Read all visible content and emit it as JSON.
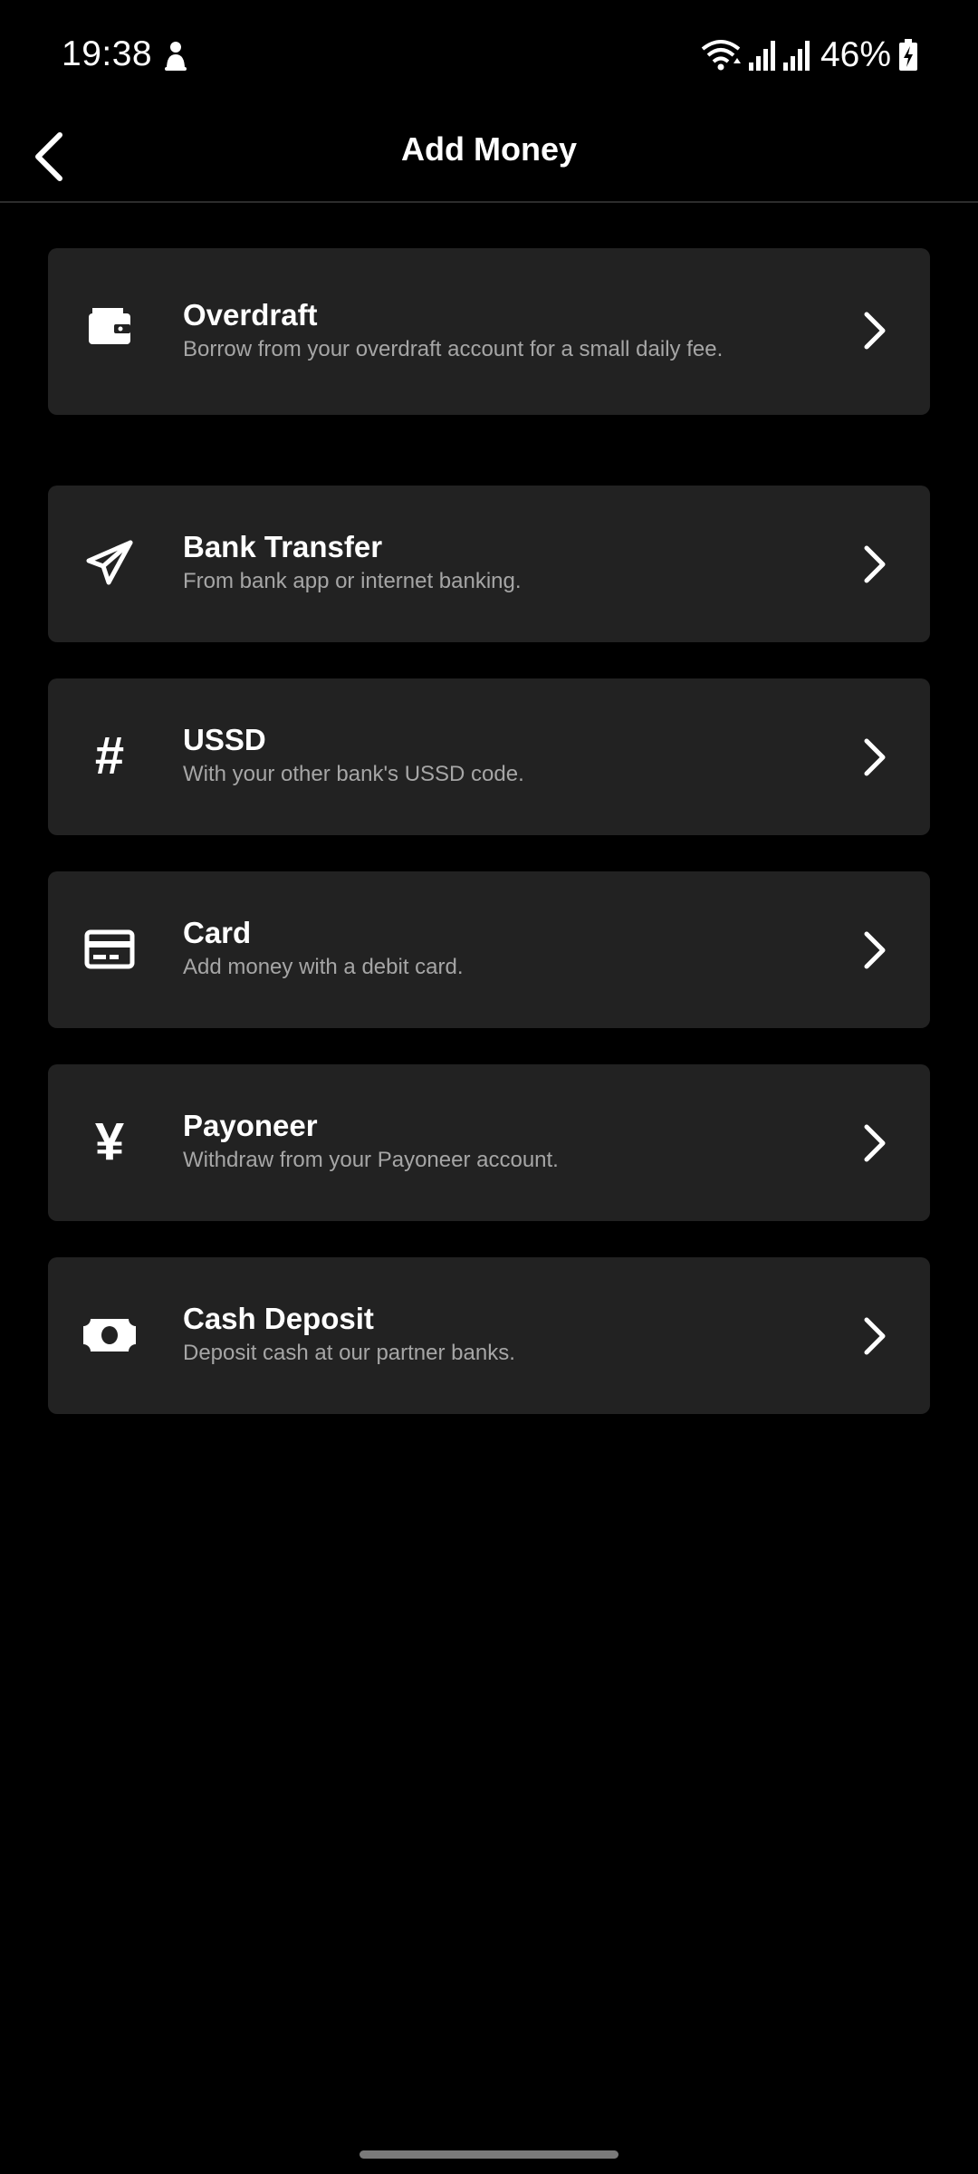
{
  "status_bar": {
    "time": "19:38",
    "battery": "46%"
  },
  "header": {
    "title": "Add Money"
  },
  "options": [
    {
      "title": "Overdraft",
      "subtitle": "Borrow from your overdraft account for a small daily fee.",
      "icon": "wallet-icon"
    },
    {
      "title": "Bank Transfer",
      "subtitle": "From bank app or internet banking.",
      "icon": "paper-plane-icon"
    },
    {
      "title": "USSD",
      "subtitle": "With your other bank's USSD code.",
      "icon": "hash-icon",
      "glyph": "#"
    },
    {
      "title": "Card",
      "subtitle": "Add money with a debit card.",
      "icon": "credit-card-icon"
    },
    {
      "title": "Payoneer",
      "subtitle": "Withdraw from your Payoneer account.",
      "icon": "yen-icon",
      "glyph": "¥"
    },
    {
      "title": "Cash Deposit",
      "subtitle": "Deposit cash at our partner banks.",
      "icon": "banknote-icon"
    }
  ]
}
